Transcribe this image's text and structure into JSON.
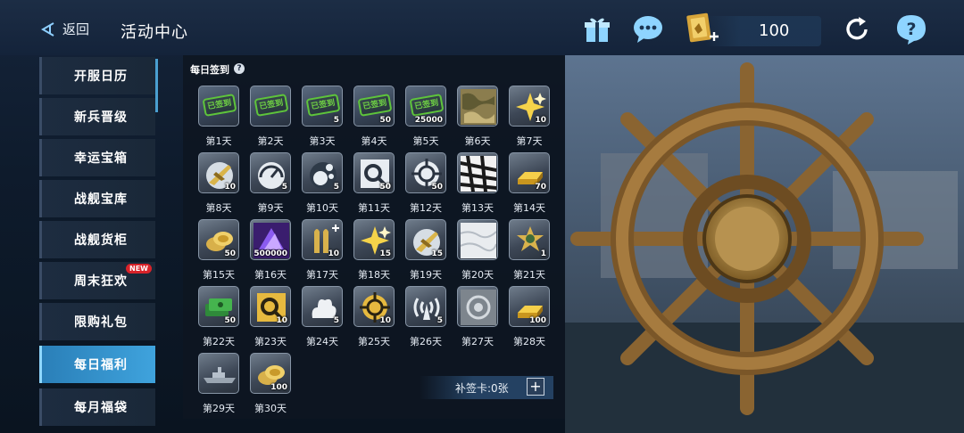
{
  "header": {
    "back_label": "返回",
    "title": "活动中心",
    "currency_value": "100",
    "icons": [
      "back-arrow-icon",
      "gift-icon",
      "chat-icon",
      "signin-card-icon",
      "refresh-icon",
      "help-icon"
    ]
  },
  "sidebar": {
    "items": [
      {
        "label": "开服日历",
        "active": false
      },
      {
        "label": "新兵晋级",
        "active": false
      },
      {
        "label": "幸运宝箱",
        "active": false
      },
      {
        "label": "战舰宝库",
        "active": false
      },
      {
        "label": "战舰货柜",
        "active": false
      },
      {
        "label": "周末狂欢",
        "active": false,
        "badge": "NEW"
      },
      {
        "label": "限购礼包",
        "active": false
      },
      {
        "label": "每日福利",
        "active": true
      },
      {
        "label": "每月福袋",
        "active": false
      }
    ]
  },
  "panel": {
    "title": "每日签到",
    "help": "?",
    "claimed_stamp": "已签到",
    "days": [
      {
        "label": "第1天",
        "icon": "claimed",
        "qty": "",
        "claimed": true
      },
      {
        "label": "第2天",
        "icon": "claimed",
        "qty": "",
        "claimed": true
      },
      {
        "label": "第3天",
        "icon": "claimed",
        "qty": "5",
        "claimed": true
      },
      {
        "label": "第4天",
        "icon": "claimed",
        "qty": "50",
        "claimed": true
      },
      {
        "label": "第5天",
        "icon": "claimed",
        "qty": "25000",
        "claimed": true
      },
      {
        "label": "第6天",
        "icon": "camo-skin-icon",
        "qty": "",
        "claimed": false
      },
      {
        "label": "第7天",
        "icon": "star-icon",
        "qty": "10",
        "claimed": false
      },
      {
        "label": "第8天",
        "icon": "aircraft-icon",
        "qty": "10",
        "claimed": false
      },
      {
        "label": "第9天",
        "icon": "gauge-icon",
        "qty": "5",
        "claimed": false
      },
      {
        "label": "第10天",
        "icon": "bubbles-icon",
        "qty": "5",
        "claimed": false
      },
      {
        "label": "第11天",
        "icon": "search-target-icon",
        "qty": "50",
        "claimed": false
      },
      {
        "label": "第12天",
        "icon": "crosshair-icon",
        "qty": "50",
        "claimed": false
      },
      {
        "label": "第13天",
        "icon": "zebra-skin-icon",
        "qty": "",
        "claimed": false
      },
      {
        "label": "第14天",
        "icon": "gold-bar-icon",
        "qty": "70",
        "claimed": false
      },
      {
        "label": "第15天",
        "icon": "coins-icon",
        "qty": "50",
        "claimed": false
      },
      {
        "label": "第16天",
        "icon": "crystal-icon",
        "qty": "500000",
        "claimed": false
      },
      {
        "label": "第17天",
        "icon": "ammo-icon",
        "qty": "10",
        "claimed": false
      },
      {
        "label": "第18天",
        "icon": "star-icon",
        "qty": "15",
        "claimed": false
      },
      {
        "label": "第19天",
        "icon": "aircraft-icon",
        "qty": "15",
        "claimed": false
      },
      {
        "label": "第20天",
        "icon": "marble-skin-icon",
        "qty": "",
        "claimed": false
      },
      {
        "label": "第21天",
        "icon": "emblem-icon",
        "qty": "1",
        "claimed": false
      },
      {
        "label": "第22天",
        "icon": "cash-icon",
        "qty": "50",
        "claimed": false
      },
      {
        "label": "第23天",
        "icon": "gold-search-icon",
        "qty": "10",
        "claimed": false
      },
      {
        "label": "第24天",
        "icon": "explosion-icon",
        "qty": "5",
        "claimed": false
      },
      {
        "label": "第25天",
        "icon": "gold-crosshair-icon",
        "qty": "10",
        "claimed": false
      },
      {
        "label": "第26天",
        "icon": "signal-icon",
        "qty": "5",
        "claimed": false
      },
      {
        "label": "第27天",
        "icon": "engraved-skin-icon",
        "qty": "",
        "claimed": false
      },
      {
        "label": "第28天",
        "icon": "gold-bar-icon",
        "qty": "100",
        "claimed": false
      },
      {
        "label": "第29天",
        "icon": "warship-icon",
        "qty": "",
        "claimed": false
      },
      {
        "label": "第30天",
        "icon": "coins-icon",
        "qty": "100",
        "claimed": false
      }
    ],
    "makeup_card_label": "补签卡:0张",
    "makeup_card_plus": "+"
  },
  "colors": {
    "active_tab": "#3fa3dd",
    "claimed_stamp": "#6fd144",
    "badge_new": "#d8232a"
  }
}
